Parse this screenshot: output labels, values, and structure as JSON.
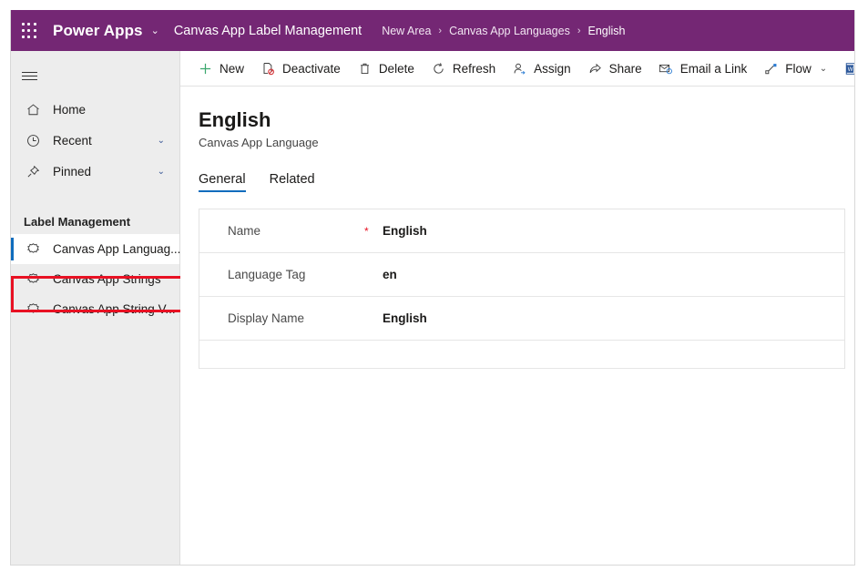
{
  "header": {
    "waffle_icon": "app-launcher-waffle-icon",
    "brand": "Power Apps",
    "brand_chevron": "⌄",
    "app_name": "Canvas App Label Management",
    "breadcrumb": [
      {
        "label": "New Area"
      },
      {
        "label": "Canvas App Languages"
      },
      {
        "label": "English"
      }
    ],
    "breadcrumb_separator": "›",
    "purple": "#742774"
  },
  "sidebar": {
    "hamburger_icon": "hamburger-menu-icon",
    "items": [
      {
        "label": "Home",
        "icon": "home-icon",
        "chevron": ""
      },
      {
        "label": "Recent",
        "icon": "clock-icon",
        "chevron": "⌄"
      },
      {
        "label": "Pinned",
        "icon": "pin-icon",
        "chevron": "⌄"
      }
    ],
    "group_label": "Label Management",
    "entities": [
      {
        "label": "Canvas App Languag...",
        "icon": "entity-cog-icon",
        "selected": true
      },
      {
        "label": "Canvas App Strings",
        "icon": "entity-cog-icon",
        "selected": false
      },
      {
        "label": "Canvas App String V...",
        "icon": "entity-cog-icon",
        "selected": false
      }
    ],
    "highlight_color": "#e81123",
    "selected_indicator_color": "#0f6cbd"
  },
  "commandbar": {
    "commands": [
      {
        "label": "New",
        "icon": "plus-icon",
        "chevron": ""
      },
      {
        "label": "Deactivate",
        "icon": "deactivate-icon",
        "chevron": ""
      },
      {
        "label": "Delete",
        "icon": "trash-icon",
        "chevron": ""
      },
      {
        "label": "Refresh",
        "icon": "refresh-icon",
        "chevron": ""
      },
      {
        "label": "Assign",
        "icon": "assign-person-icon",
        "chevron": ""
      },
      {
        "label": "Share",
        "icon": "share-icon",
        "chevron": ""
      },
      {
        "label": "Email a Link",
        "icon": "email-link-icon",
        "chevron": ""
      },
      {
        "label": "Flow",
        "icon": "flow-icon",
        "chevron": "⌄"
      },
      {
        "label": "",
        "icon": "word-template-icon",
        "chevron": ""
      }
    ]
  },
  "record": {
    "title": "English",
    "subtitle": "Canvas App Language",
    "tabs": [
      {
        "label": "General",
        "active": true
      },
      {
        "label": "Related",
        "active": false
      }
    ],
    "fields": [
      {
        "label": "Name",
        "required": "*",
        "value": "English"
      },
      {
        "label": "Language Tag",
        "required": "",
        "value": "en"
      },
      {
        "label": "Display Name",
        "required": "",
        "value": "English"
      }
    ]
  }
}
